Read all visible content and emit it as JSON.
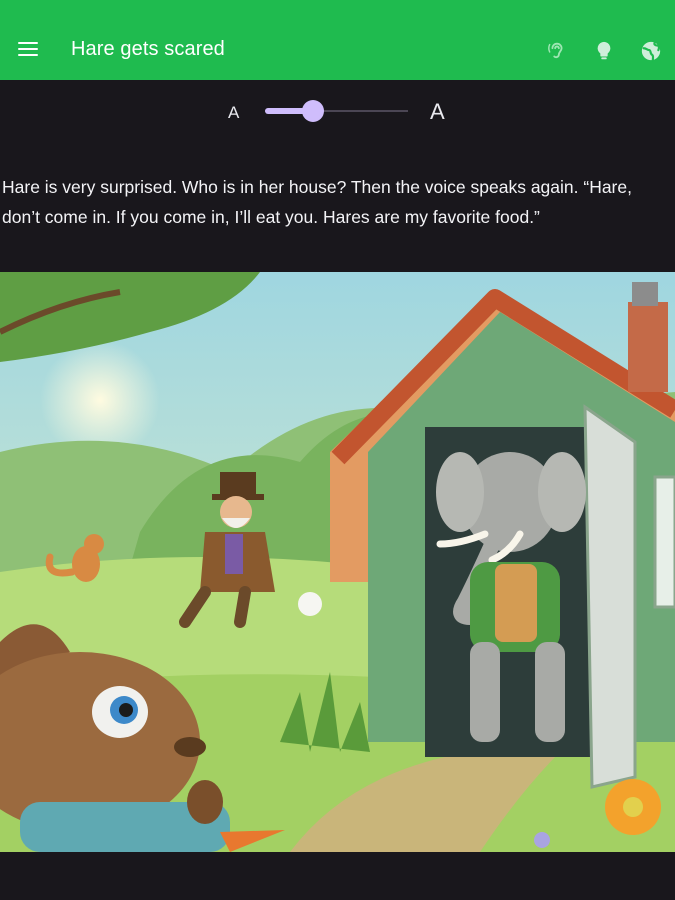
{
  "app_bar": {
    "title": "Hare gets scared",
    "color": "#1fbb4f",
    "icons": [
      "menu-icon",
      "hearing-icon",
      "lightbulb-icon",
      "globe-icon"
    ]
  },
  "text_size": {
    "small_label": "A",
    "large_label": "A",
    "level": 0.33,
    "accent": "#cfbdfc"
  },
  "story": {
    "text": "Hare is very surprised. Who is in her house? Then the voice speaks again. “Hare, don’t come in. If you come in, I’ll eat you. Hares are my favorite food.”"
  },
  "illustration": {
    "subject": "storybook-illustration"
  }
}
